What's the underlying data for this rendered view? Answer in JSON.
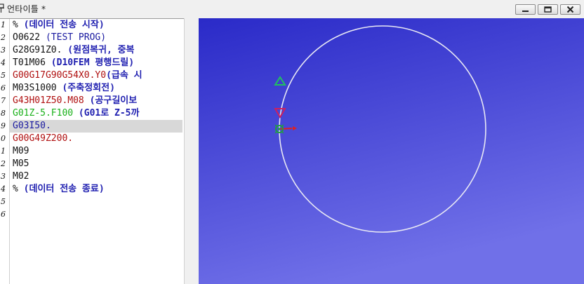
{
  "window": {
    "title": "언타이틀 *",
    "icon": "pin-icon",
    "buttons": [
      {
        "name": "minimize",
        "icon": "minimize-icon"
      },
      {
        "name": "restore",
        "icon": "restore-icon"
      },
      {
        "name": "close",
        "icon": "close-icon"
      }
    ]
  },
  "editor": {
    "gutter_numbers": [
      "1",
      "2",
      "3",
      "4",
      "5",
      "6",
      "7",
      "8",
      "9",
      "0",
      "1",
      "2",
      "3",
      "4",
      "5",
      "6"
    ],
    "lines": [
      [
        {
          "t": "% ",
          "c": "black"
        },
        {
          "t": "(데이터 전송 시작)",
          "c": "blue"
        }
      ],
      [
        {
          "t": "O0622 ",
          "c": "black"
        },
        {
          "t": "(TEST PROG)",
          "c": "darkblue"
        }
      ],
      [
        {
          "t": "G28G91Z0. ",
          "c": "black"
        },
        {
          "t": "(원점복귀, 중복",
          "c": "blue"
        }
      ],
      [
        {
          "t": "T01M06 ",
          "c": "black"
        },
        {
          "t": "(D10FEM 평행드릴)",
          "c": "blue"
        }
      ],
      [
        {
          "t": "G00G17G90G54X0.Y0",
          "c": "red"
        },
        {
          "t": "(급속 시",
          "c": "blue"
        }
      ],
      [
        {
          "t": "M03S1000 ",
          "c": "black"
        },
        {
          "t": "(주축정회전)",
          "c": "blue"
        }
      ],
      [
        {
          "t": "G43H01Z50.M08 ",
          "c": "red"
        },
        {
          "t": "(공구길이보",
          "c": "blue"
        }
      ],
      [
        {
          "t": "G01Z-5.F100 ",
          "c": "green"
        },
        {
          "t": "(G01로 Z-5까",
          "c": "blue"
        }
      ],
      [
        {
          "t": "G03I50.",
          "c": "darkblue"
        }
      ],
      [
        {
          "t": "G00G49Z200.",
          "c": "red"
        }
      ],
      [
        {
          "t": "M09",
          "c": "black"
        }
      ],
      [
        {
          "t": "M05",
          "c": "black"
        }
      ],
      [
        {
          "t": "M02",
          "c": "black"
        }
      ],
      [
        {
          "t": "% ",
          "c": "black"
        },
        {
          "t": "(데이터 전송 종료)",
          "c": "blue"
        }
      ],
      [],
      []
    ],
    "highlighted_line": 8
  },
  "viewport": {
    "background_top": "#2a2ac8",
    "background_bottom": "#7070e8",
    "circle_color": "#e8e8f4",
    "tool_marker_color": "#cc2060",
    "start_marker_color": "#20c060",
    "axis_x_color": "#e02020",
    "origin_color": "#20a040"
  }
}
